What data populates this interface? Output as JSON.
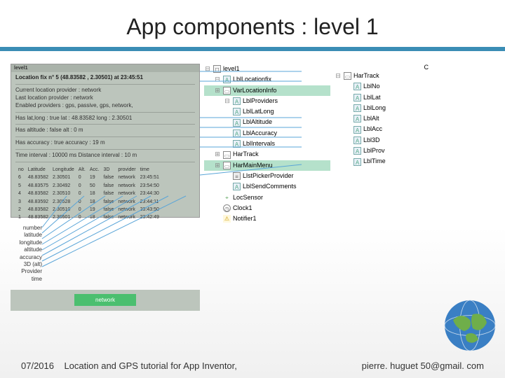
{
  "title": "App components : level 1",
  "footer": {
    "date": "07/2016",
    "caption": "Location and GPS tutorial for App Inventor,",
    "email": "pierre. huguet 50@gmail. com"
  },
  "phone": {
    "titlebar": "level1",
    "fix_line": "Location fix n° 5 (48.83582 , 2.30501) at 23:45:51",
    "current_provider": "Current location provider : network",
    "last_provider": "Last location provider     : network",
    "enabled": "Enabled providers : gps, passive, gps, network,",
    "latlong": "Has lat,long : true  lat : 48.83582 long : 2.30501",
    "altitude": "Has altitude : false alt : 0 m",
    "accuracy": "Has accuracy : true   accuracy : 19 m",
    "interval": "Time interval : 10000 ms  Distance interval : 10 m",
    "headers": [
      "no",
      "Latitude",
      "Longitude",
      "Alt.",
      "Acc.",
      "3D",
      "provider",
      "time"
    ],
    "rows": [
      [
        "6",
        "48.83582",
        "2.30501",
        "0",
        "19",
        "false",
        "network",
        "23:45:51"
      ],
      [
        "5",
        "48.83575",
        "2.30492",
        "0",
        "50",
        "false",
        "network",
        "23:54:50"
      ],
      [
        "4",
        "48.83582",
        "2.30510",
        "0",
        "18",
        "false",
        "network",
        "23:44:30"
      ],
      [
        "3",
        "48.83592",
        "2.30528",
        "0",
        "18",
        "false",
        "network",
        "23:44:11"
      ],
      [
        "2",
        "48.83582",
        "2.30510",
        "0",
        "19",
        "false",
        "network",
        "23:43:50"
      ],
      [
        "1",
        "48.83582",
        "2.30501",
        "0",
        "18",
        "false",
        "network",
        "23:42:49"
      ]
    ],
    "button": "network"
  },
  "labels": [
    "number",
    "latitude",
    "longitude",
    "altitude",
    "accuracy",
    "3D (alt)",
    "Provider",
    "time"
  ],
  "tree_main": [
    {
      "type": "container",
      "name": "level1",
      "icon": "□",
      "expand": "⊟"
    },
    {
      "type": "A",
      "name": "LblLocationfix",
      "expand": "⊟",
      "indent": 1
    },
    {
      "type": "H",
      "name": "VarLocationInfo",
      "icon": "▭",
      "expand": "⊞",
      "indent": 1,
      "sel": true
    },
    {
      "type": "A",
      "name": "LblProviders",
      "expand": "⊟",
      "indent": 2
    },
    {
      "type": "A",
      "name": "LblLatLong",
      "indent": 2
    },
    {
      "type": "A",
      "name": "LblAltitude",
      "indent": 2
    },
    {
      "type": "A",
      "name": "LblAccuracy",
      "indent": 2
    },
    {
      "type": "A",
      "name": "LblIntervals",
      "indent": 2
    },
    {
      "type": "H",
      "name": "HarTrack",
      "icon": "▭",
      "expand": "⊞",
      "indent": 1
    },
    {
      "type": "H",
      "name": "HarMainMenu",
      "icon": "▭",
      "expand": "⊞",
      "indent": 1,
      "sel": true
    },
    {
      "type": "list",
      "name": "LlstPickerProvider",
      "icon": "≡",
      "expand": "",
      "indent": 2
    },
    {
      "type": "A",
      "name": "LblSendComments",
      "indent": 2
    },
    {
      "type": "loc",
      "name": "LocSensor",
      "icon": "⌖",
      "indent": 1
    },
    {
      "type": "clock",
      "name": "Clock1",
      "icon": "◷",
      "indent": 1
    },
    {
      "type": "warn",
      "name": "Notifier1",
      "icon": "⚠",
      "indent": 1
    }
  ],
  "tree_right_header": "C",
  "tree_right": [
    {
      "name": "HarTrack",
      "type": "H"
    },
    {
      "name": "LblNo",
      "type": "A"
    },
    {
      "name": "LblLat",
      "type": "A"
    },
    {
      "name": "LblLong",
      "type": "A"
    },
    {
      "name": "LblAlt",
      "type": "A"
    },
    {
      "name": "LblAcc",
      "type": "A"
    },
    {
      "name": "Lbl3D",
      "type": "A"
    },
    {
      "name": "LblProv",
      "type": "A"
    },
    {
      "name": "LblTime",
      "type": "A"
    }
  ]
}
